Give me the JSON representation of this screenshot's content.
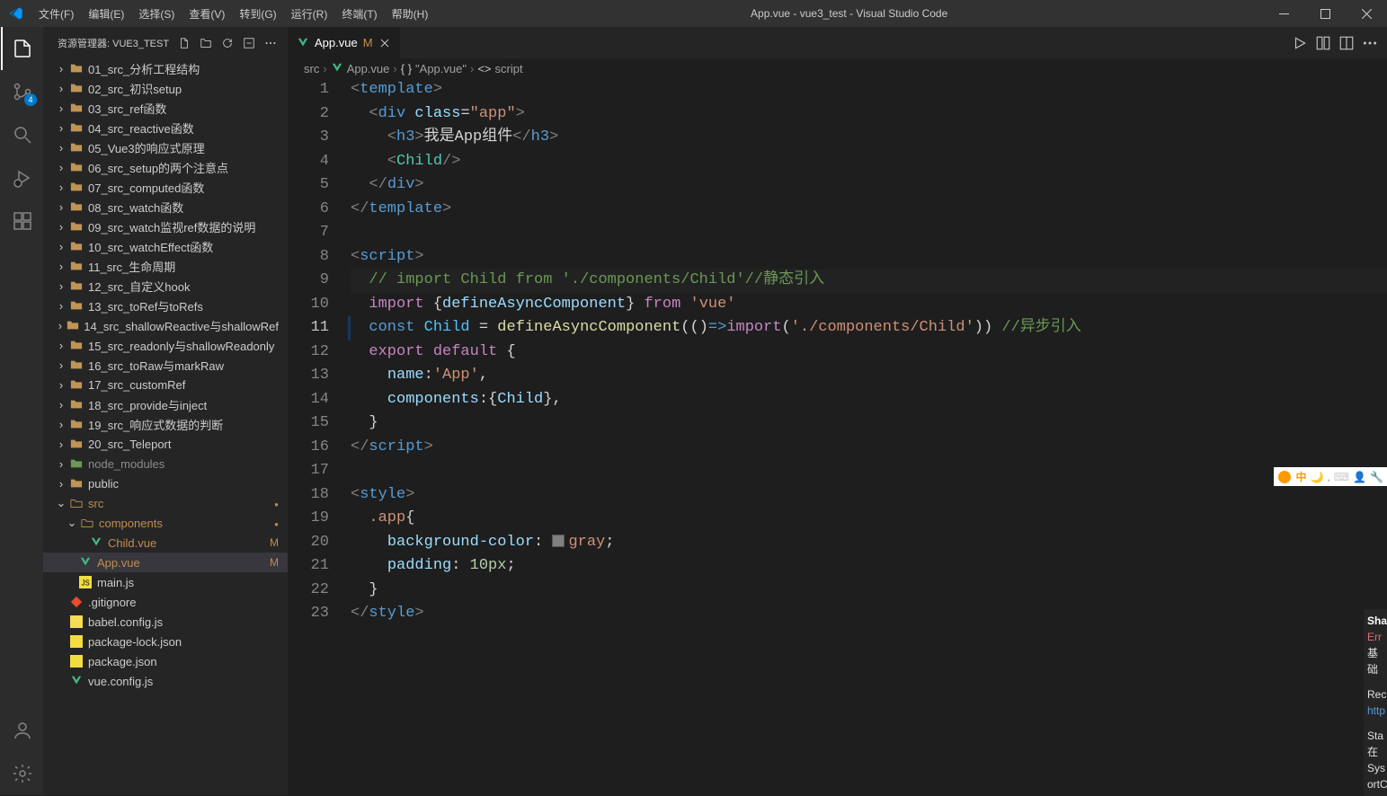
{
  "window": {
    "title": "App.vue - vue3_test - Visual Studio Code"
  },
  "menu": [
    "文件(F)",
    "编辑(E)",
    "选择(S)",
    "查看(V)",
    "转到(G)",
    "运行(R)",
    "终端(T)",
    "帮助(H)"
  ],
  "activity": {
    "scm_badge": "4"
  },
  "sidebar": {
    "title": "资源管理器: VUE3_TEST",
    "folders": [
      "01_src_分析工程结构",
      "02_src_初识setup",
      "03_src_ref函数",
      "04_src_reactive函数",
      "05_Vue3的响应式原理",
      "06_src_setup的两个注意点",
      "07_src_computed函数",
      "08_src_watch函数",
      "09_src_watch监视ref数据的说明",
      "10_src_watchEffect函数",
      "11_src_生命周期",
      "12_src_自定义hook",
      "13_src_toRef与toRefs",
      "14_src_shallowReactive与shallowRef",
      "15_src_readonly与shallowReadonly",
      "16_src_toRaw与markRaw",
      "17_src_customRef",
      "18_src_provide与inject",
      "19_src_响应式数据的判断",
      "20_src_Teleport"
    ],
    "node_modules": "node_modules",
    "public": "public",
    "src": {
      "name": "src",
      "components": {
        "name": "components",
        "child": {
          "name": "Child.vue",
          "status": "M"
        }
      },
      "app": {
        "name": "App.vue",
        "status": "M"
      },
      "main": "main.js"
    },
    "files": [
      ".gitignore",
      "babel.config.js",
      "package-lock.json",
      "package.json",
      "vue.config.js"
    ]
  },
  "tab": {
    "name": "App.vue",
    "mod": "M"
  },
  "breadcrumb": {
    "p1": "src",
    "p2": "App.vue",
    "p3": "\"App.vue\"",
    "p4": "script"
  },
  "code": {
    "l1_template": "template",
    "l2_div": "div",
    "l2_class": "class",
    "l2_app": "\"app\"",
    "l3_h3": "h3",
    "l3_text": "我是App组件",
    "l4_child": "Child",
    "l8_script": "script",
    "l9_comment": "// import Child from './components/Child'//静态引入",
    "l10_import": "import",
    "l10_dac": "defineAsyncComponent",
    "l10_from": "from",
    "l10_vue": "'vue'",
    "l11_const": "const",
    "l11_child": "Child",
    "l11_eq": " = ",
    "l11_dac": "defineAsyncComponent",
    "l11_arrow": "=>",
    "l11_import": "import",
    "l11_path": "'./components/Child'",
    "l11_comment": "//异步引入",
    "l12_export": "export",
    "l12_default": "default",
    "l13_name": "name",
    "l13_app": "'App'",
    "l14_components": "components",
    "l14_child": "Child",
    "l17_style": "style",
    "l18_app": ".app",
    "l19_bg": "background-color",
    "l19_gray": "gray",
    "l20_padding": "padding",
    "l20_10px": "10px"
  },
  "sha": {
    "head": "Sha",
    "l1": "Err",
    "l2": "基础",
    "l3": "Rec",
    "l4": "http",
    "l5": "Sta",
    "l6": "在",
    "l7": "Sys",
    "l8": "ortC"
  }
}
